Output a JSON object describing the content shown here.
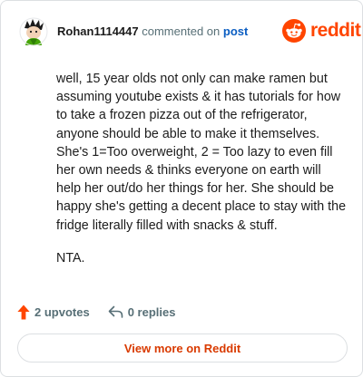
{
  "header": {
    "username": "Rohan1114447",
    "action_text": "commented on",
    "post_link": "post",
    "brand": "reddit"
  },
  "comment": {
    "paragraphs": [
      "well, 15 year olds not only can make ramen but assuming youtube exists & it has tutorials for how to take a frozen pizza out of the refrigerator, anyone should be able to make it themselves. She's 1=Too overweight, 2 = Too lazy to even fill her own needs & thinks everyone on earth will help her out/do her things for her. She should be happy she's getting a decent place to stay with the fridge literally filled with snacks & stuff.",
      "NTA."
    ]
  },
  "actions": {
    "upvotes": "2 upvotes",
    "replies": "0 replies"
  },
  "view_more": "View more on Reddit",
  "colors": {
    "brand": "#ff4500",
    "link": "#0a5dc2",
    "muted": "#576f76",
    "view_more": "#d93a00"
  },
  "icons": [
    "avatar-icon",
    "reddit-snoo-icon",
    "upvote-arrow-icon",
    "reply-arrow-icon"
  ]
}
